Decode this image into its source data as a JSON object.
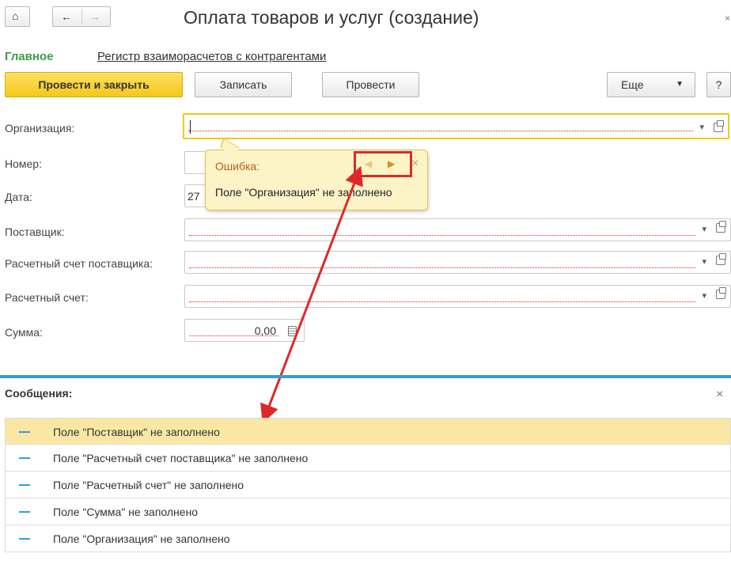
{
  "window": {
    "title": "Оплата товаров и услуг (создание)"
  },
  "tabs": {
    "main": "Главное",
    "link": "Регистр взаиморасчетов с контрагентами"
  },
  "toolbar": {
    "post_close": "Провести и закрыть",
    "save": "Записать",
    "post": "Провести",
    "more": "Еще",
    "help": "?"
  },
  "form": {
    "organization_label": "Организация:",
    "number_label": "Номер:",
    "date_label": "Дата:",
    "date_value": "27",
    "supplier_label": "Поставщик:",
    "supplier_account_label": "Расчетный счет поставщика:",
    "account_label": "Расчетный счет:",
    "sum_label": "Сумма:",
    "sum_value": "0,00"
  },
  "tooltip": {
    "title": "Ошибка:",
    "text": "Поле \"Организация\" не заполнено"
  },
  "messages": {
    "title": "Сообщения:",
    "items": [
      "Поле \"Поставщик\" не заполнено",
      "Поле \"Расчетный счет поставщика\" не заполнено",
      "Поле \"Расчетный счет\" не заполнено",
      "Поле \"Сумма\" не заполнено",
      "Поле \"Организация\" не заполнено"
    ]
  },
  "colors": {
    "accent_green": "#3a9d45",
    "primary_yellow": "#f4c81c",
    "error_red": "#e0282a",
    "messages_blue": "#2f9ed9"
  }
}
